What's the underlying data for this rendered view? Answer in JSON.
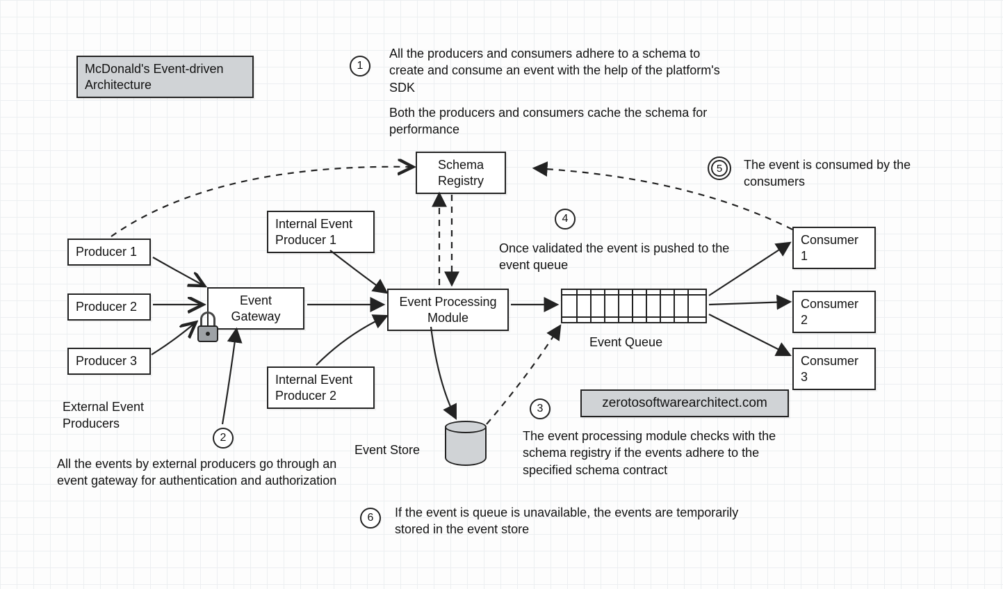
{
  "title_box": "McDonald's Event-driven Architecture",
  "step1": {
    "num": "1",
    "text_a": "All the producers and consumers adhere to a schema to create and consume an event with the help of the platform's SDK",
    "text_b": "Both the producers and consumers cache the schema for performance"
  },
  "step2": {
    "num": "2",
    "text": "All the events by external producers go through an event gateway for authentication and authorization"
  },
  "step3": {
    "num": "3",
    "text": "The event processing module checks with the schema registry if the events adhere to the specified schema contract"
  },
  "step4": {
    "num": "4",
    "text": "Once validated the event is pushed to the event queue"
  },
  "step5": {
    "num": "5",
    "text": "The event is consumed by the consumers"
  },
  "step6": {
    "num": "6",
    "text": "If the event is queue is unavailable, the events are temporarily stored in the event store"
  },
  "boxes": {
    "schema_registry": "Schema\nRegistry",
    "producer1": "Producer 1",
    "producer2": "Producer 2",
    "producer3": "Producer 3",
    "internal_producer1": "Internal Event\nProducer 1",
    "internal_producer2": "Internal Event\nProducer 2",
    "event_gateway": "Event\nGateway",
    "event_processing": "Event Processing\nModule",
    "consumer1": "Consumer 1",
    "consumer2": "Consumer 2",
    "consumer3": "Consumer 3",
    "watermark": "zerotosoftwarearchitect.com"
  },
  "labels": {
    "external_event_producers": "External Event\nProducers",
    "event_store": "Event Store",
    "event_queue": "Event Queue"
  }
}
